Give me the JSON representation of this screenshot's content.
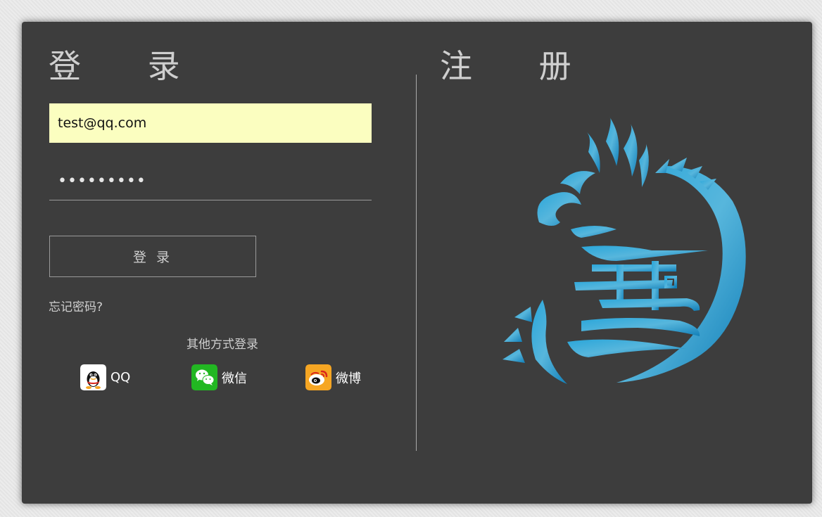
{
  "login": {
    "title": "登 录",
    "email_value": "test@qq.com",
    "password_masked": "•••••••••",
    "button_label": "登 录",
    "forgot_label": "忘记密码?"
  },
  "other_login": {
    "title": "其他方式登录",
    "providers": [
      {
        "label": "QQ",
        "icon": "qq-icon"
      },
      {
        "label": "微信",
        "icon": "wechat-icon"
      },
      {
        "label": "微博",
        "icon": "weibo-icon"
      }
    ]
  },
  "register": {
    "title": "注 册"
  },
  "colors": {
    "panel_bg": "#3d3d3d",
    "email_bg": "#fbfec0",
    "logo_accent": "#1a8fc5",
    "wechat_green": "#22b722",
    "weibo_orange": "#f6a623"
  }
}
